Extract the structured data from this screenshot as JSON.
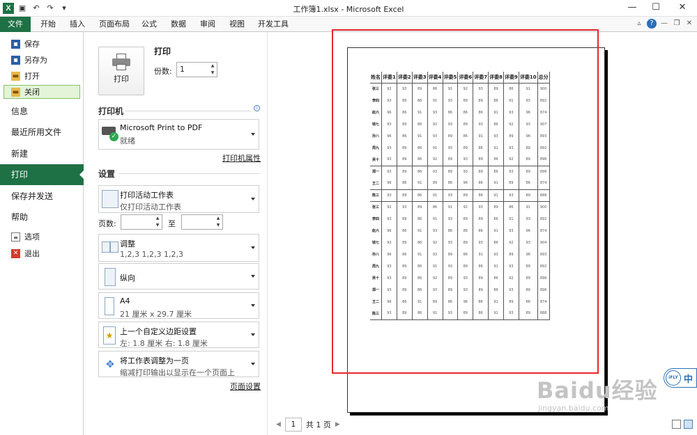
{
  "window": {
    "title": "工作簿1.xlsx - Microsoft Excel",
    "app_icon": "X",
    "controls": [
      "—",
      "☐",
      "✕"
    ]
  },
  "ribbon_tabs": [
    "文件",
    "开始",
    "插入",
    "页面布局",
    "公式",
    "数据",
    "审阅",
    "视图",
    "开发工具"
  ],
  "backstage": {
    "commands": [
      {
        "label": "保存",
        "icon": "save-icon"
      },
      {
        "label": "另存为",
        "icon": "save-as-icon"
      },
      {
        "label": "打开",
        "icon": "open-folder-icon"
      },
      {
        "label": "关闭",
        "icon": "close-file-icon"
      }
    ],
    "sections": [
      "信息",
      "最近所用文件",
      "新建",
      "打印",
      "保存并发送",
      "帮助"
    ],
    "active_section": "打印",
    "bottom": [
      {
        "label": "选项",
        "icon": "options-icon"
      },
      {
        "label": "退出",
        "icon": "exit-icon"
      }
    ]
  },
  "print": {
    "header": "打印",
    "button_label": "打印",
    "copies_label": "份数:",
    "copies_value": "1",
    "printer_section": "打印机",
    "printer_name": "Microsoft Print to PDF",
    "printer_status": "就绪",
    "printer_properties": "打印机属性",
    "settings_section": "设置",
    "what_title": "打印活动工作表",
    "what_sub": "仅打印活动工作表",
    "pages_label": "页数:",
    "to_label": "至",
    "collate_title": "调整",
    "collate_sub": "1,2,3    1,2,3    1,2,3",
    "orientation": "纵向",
    "paper_title": "A4",
    "paper_sub": "21 厘米 x 29.7 厘米",
    "margins_title": "上一个自定义边距设置",
    "margins_sub": "左:  1.8 厘米    右:  1.8 厘米",
    "scaling_title": "将工作表调整为一页",
    "scaling_sub": "缩减打印输出以显示在一个页面上",
    "page_setup": "页面设置"
  },
  "preview_nav": {
    "current_page": "1",
    "total": "共 1 页"
  },
  "sheet": {
    "headers": [
      "姓名",
      "评委1",
      "评委2",
      "评委3",
      "评委4",
      "评委5",
      "评委6",
      "评委7",
      "评委8",
      "评委9",
      "评委10",
      "总分"
    ],
    "rows": [
      [
        "张三",
        "92",
        "93",
        "89",
        "86",
        "91",
        "92",
        "93",
        "89",
        "86",
        "91",
        "900"
      ],
      [
        "李四",
        "93",
        "89",
        "86",
        "91",
        "93",
        "89",
        "89",
        "86",
        "91",
        "93",
        "892"
      ],
      [
        "赵六",
        "96",
        "86",
        "91",
        "93",
        "86",
        "86",
        "86",
        "91",
        "93",
        "96",
        "874"
      ],
      [
        "钱七",
        "93",
        "89",
        "86",
        "92",
        "93",
        "89",
        "93",
        "86",
        "92",
        "93",
        "907"
      ],
      [
        "孙八",
        "96",
        "86",
        "91",
        "93",
        "89",
        "86",
        "91",
        "93",
        "89",
        "96",
        "893"
      ],
      [
        "周九",
        "93",
        "89",
        "86",
        "91",
        "93",
        "89",
        "86",
        "91",
        "93",
        "89",
        "892"
      ],
      [
        "吴十",
        "93",
        "89",
        "86",
        "92",
        "89",
        "93",
        "89",
        "86",
        "92",
        "89",
        "896"
      ],
      [
        "郑一",
        "93",
        "89",
        "86",
        "93",
        "89",
        "93",
        "89",
        "86",
        "93",
        "89",
        "896"
      ],
      [
        "王二",
        "96",
        "86",
        "91",
        "89",
        "86",
        "96",
        "86",
        "91",
        "89",
        "86",
        "874"
      ],
      [
        "陈三",
        "93",
        "89",
        "86",
        "91",
        "93",
        "89",
        "86",
        "91",
        "93",
        "89",
        "888"
      ],
      [
        "张三",
        "92",
        "93",
        "89",
        "86",
        "91",
        "92",
        "93",
        "89",
        "86",
        "91",
        "900"
      ],
      [
        "李四",
        "93",
        "89",
        "86",
        "91",
        "93",
        "89",
        "89",
        "86",
        "91",
        "93",
        "892"
      ],
      [
        "赵六",
        "96",
        "86",
        "91",
        "93",
        "86",
        "86",
        "86",
        "91",
        "93",
        "96",
        "874"
      ],
      [
        "钱七",
        "93",
        "89",
        "86",
        "92",
        "93",
        "89",
        "93",
        "86",
        "92",
        "93",
        "904"
      ],
      [
        "孙八",
        "96",
        "86",
        "91",
        "93",
        "89",
        "86",
        "91",
        "93",
        "89",
        "96",
        "893"
      ],
      [
        "周九",
        "93",
        "89",
        "86",
        "91",
        "93",
        "89",
        "86",
        "91",
        "93",
        "89",
        "892"
      ],
      [
        "吴十",
        "93",
        "89",
        "86",
        "92",
        "89",
        "93",
        "89",
        "86",
        "92",
        "89",
        "896"
      ],
      [
        "郑一",
        "93",
        "89",
        "86",
        "93",
        "89",
        "93",
        "89",
        "86",
        "93",
        "89",
        "896"
      ],
      [
        "王二",
        "96",
        "86",
        "91",
        "89",
        "86",
        "96",
        "86",
        "91",
        "89",
        "86",
        "874"
      ],
      [
        "陈三",
        "93",
        "89",
        "86",
        "91",
        "93",
        "89",
        "86",
        "91",
        "93",
        "89",
        "888"
      ]
    ]
  },
  "watermark": {
    "text": "Baidu经验",
    "url": "jingyan.baidu.com",
    "ifly": "iFLY",
    "ifly_char": "中"
  },
  "colors": {
    "accent": "#1e7145",
    "highlight": "#e8262e"
  }
}
